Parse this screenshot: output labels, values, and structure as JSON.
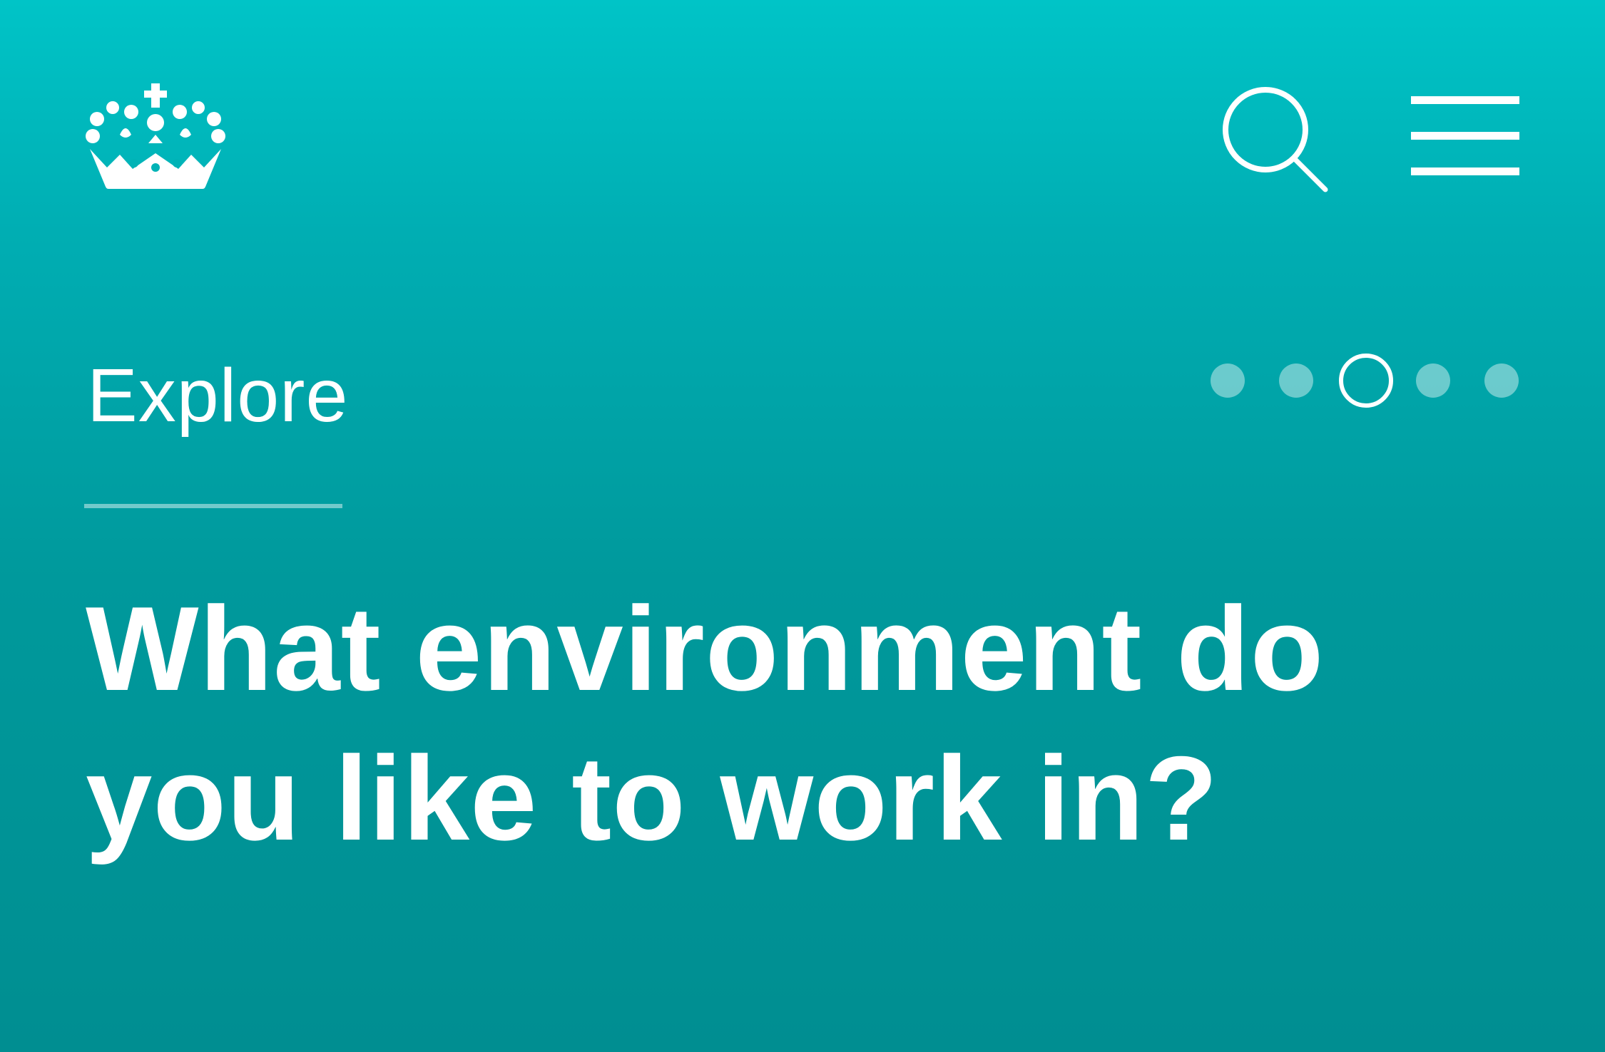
{
  "header": {
    "logo_icon": "crown-icon",
    "search_icon": "search-icon",
    "menu_icon": "hamburger-menu-icon"
  },
  "section": {
    "label": "Explore"
  },
  "pager": {
    "total": 5,
    "active_index": 2
  },
  "main": {
    "headline": "What environment do you like to work in?"
  },
  "colors": {
    "background_top": "#00c4c7",
    "background_bottom": "#008e91",
    "foreground": "#ffffff"
  }
}
